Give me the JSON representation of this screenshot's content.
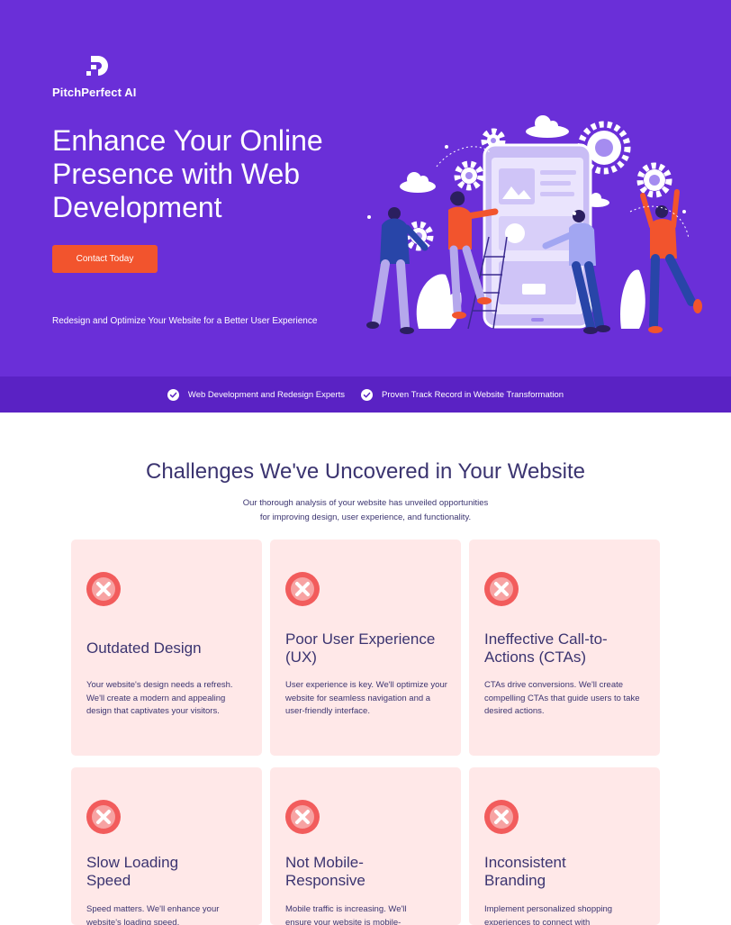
{
  "hero": {
    "brand_name": "PitchPerfect AI",
    "title": "Enhance Your Online Presence with Web Development",
    "cta_label": "Contact Today",
    "subtitle": "Redesign and Optimize Your Website for a Better User Experience",
    "illustration": "team-building-website-illustration"
  },
  "trust_bar": {
    "items": [
      {
        "icon": "check-circle-icon",
        "label": "Web Development and Redesign Experts"
      },
      {
        "icon": "check-circle-icon",
        "label": "Proven Track Record in Website Transformation"
      }
    ]
  },
  "challenges": {
    "title": "Challenges We've Uncovered in Your Website",
    "subtitle_line1": "Our thorough analysis of your website has unveiled opportunities",
    "subtitle_line2": "for improving design, user experience, and functionality.",
    "cards": [
      {
        "icon": "x-circle-icon",
        "title": "Outdated Design",
        "text": "Your website's design needs a refresh. We'll create a modern and appealing design that captivates your visitors."
      },
      {
        "icon": "x-circle-icon",
        "title": "Poor User Experience (UX)",
        "text": "User experience is key. We'll optimize your website for seamless navigation and a user-friendly interface."
      },
      {
        "icon": "x-circle-icon",
        "title": "Ineffective Call-to-Actions (CTAs)",
        "text": "CTAs drive conversions. We'll create compelling CTAs that guide users to take desired actions."
      },
      {
        "icon": "x-circle-icon",
        "title": "Slow Loading Speed",
        "text": "Speed matters. We'll enhance your website's loading speed."
      },
      {
        "icon": "x-circle-icon",
        "title": "Not Mobile-Responsive",
        "text": "Mobile traffic is increasing. We'll ensure your website is mobile-"
      },
      {
        "icon": "x-circle-icon",
        "title": "Inconsistent Branding",
        "text": "Implement personalized shopping experiences to connect with"
      }
    ]
  },
  "colors": {
    "hero_bg": "#6a2fd8",
    "trust_bar_bg": "#5a22c4",
    "cta": "#f2542d",
    "card_bg": "#ffe8e8",
    "icon_red": "#f25c5c",
    "heading_text": "#3b3470"
  }
}
